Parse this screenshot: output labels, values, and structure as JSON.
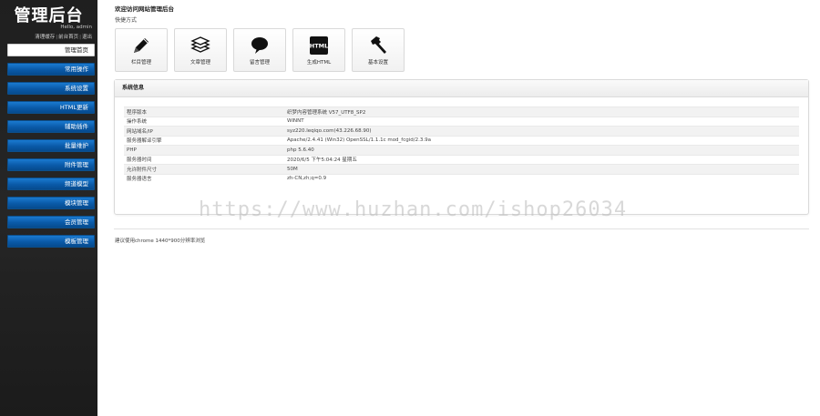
{
  "sidebar": {
    "brand": "管理后台",
    "greeting": "Hello, admin",
    "links": [
      "清理缓存",
      "前台首页",
      "退出"
    ],
    "items": [
      {
        "label": "管理首页",
        "active": true
      },
      {
        "label": "常用操作"
      },
      {
        "label": "系统设置"
      },
      {
        "label": "HTML更新"
      },
      {
        "label": "辅助插件"
      },
      {
        "label": "批量维护"
      },
      {
        "label": "附件管理"
      },
      {
        "label": "频道模型"
      },
      {
        "label": "模块管理"
      },
      {
        "label": "会员管理"
      },
      {
        "label": "模板管理"
      }
    ]
  },
  "main": {
    "welcome": "欢迎访问网站管理后台",
    "quick_title": "快捷方式",
    "quick": [
      {
        "label": "栏目管理",
        "icon": "pencil-icon"
      },
      {
        "label": "文章管理",
        "icon": "document-stack-icon"
      },
      {
        "label": "留言管理",
        "icon": "speech-bubble-icon"
      },
      {
        "label": "生成HTML",
        "icon": "html-icon",
        "icon_text": "HTML"
      },
      {
        "label": "基本设置",
        "icon": "hammer-icon"
      }
    ],
    "sysinfo": {
      "title": "系统信息",
      "rows": [
        {
          "k": "程序版本",
          "v": "织梦内容管理系统 V57_UTF8_SP2"
        },
        {
          "k": "操作系统",
          "v": "WINNT"
        },
        {
          "k": "网站域名/IP",
          "v": "syz220.leqiqo.com(43.226.68.90)"
        },
        {
          "k": "服务器解译引擎",
          "v": "Apache/2.4.41 (Win32) OpenSSL/1.1.1c mod_fcgid/2.3.9a"
        },
        {
          "k": "PHP",
          "v": "php 5.6.40"
        },
        {
          "k": "服务器时间",
          "v": "2020/6/5 下午5:04:24 星期五"
        },
        {
          "k": "允许附件尺寸",
          "v": "50M"
        },
        {
          "k": "服务器语言",
          "v": "zh-CN,zh;q=0.9"
        }
      ]
    },
    "footer": "建议使用chrome 1440*900分辨率浏览"
  },
  "watermark": "https://www.huzhan.com/ishop26034"
}
